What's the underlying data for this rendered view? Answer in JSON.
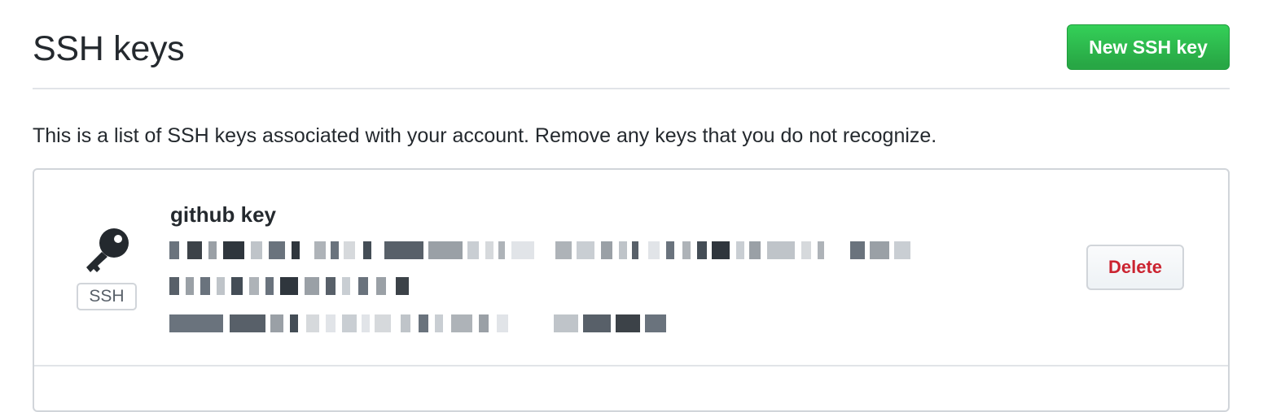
{
  "header": {
    "title": "SSH keys",
    "new_key_label": "New SSH key"
  },
  "intro": "This is a list of SSH keys associated with your account. Remove any keys that you do not recognize.",
  "keys": [
    {
      "title": "github key",
      "type_badge": "SSH",
      "icon": "key-icon",
      "details_redacted": true,
      "delete_label": "Delete"
    }
  ],
  "colors": {
    "primary_button": "#28a745",
    "danger_text": "#cb2431",
    "border": "#d1d5da"
  }
}
